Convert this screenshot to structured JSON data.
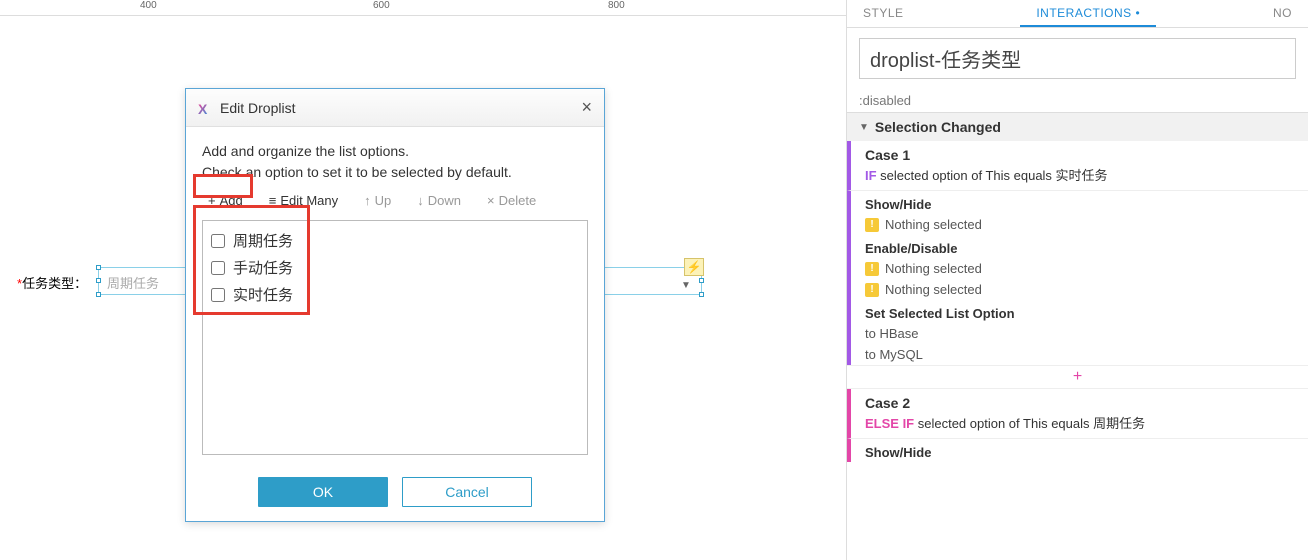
{
  "ruler": {
    "t400": "400",
    "t600": "600",
    "t800": "800"
  },
  "canvas": {
    "labelReq": "*",
    "label": "任务类型：",
    "placeholder": "周期任务",
    "lightning": "⚡"
  },
  "dialog": {
    "title": "Edit Droplist",
    "desc1": "Add and organize the list options.",
    "desc2": "Check an option to set it to be selected by default.",
    "add": "Add",
    "editMany": "Edit Many",
    "up": "Up",
    "down": "Down",
    "delete": "Delete",
    "items": {
      "i0": "周期任务",
      "i1": "手动任务",
      "i2": "实时任务"
    },
    "ok": "OK",
    "cancel": "Cancel"
  },
  "panel": {
    "tabStyle": "STYLE",
    "tabInteractions": "INTERACTIONS",
    "tabNotes": "NO",
    "widgetName": "droplist-任务类型",
    "state": ":disabled",
    "sectionTitle": "Selection Changed",
    "case1": {
      "title": "Case 1",
      "kw": "IF",
      "cond": " selected option of This equals 实时任务",
      "showHide": "Show/Hide",
      "nothing": "Nothing selected",
      "enableDisable": "Enable/Disable",
      "setSel": "Set Selected List Option",
      "toHBase": "to HBase",
      "toMySQL": "to MySQL"
    },
    "plus": "+",
    "case2": {
      "title": "Case 2",
      "kw": "ELSE IF",
      "cond": " selected option of This equals 周期任务",
      "showHide": "Show/Hide"
    }
  }
}
